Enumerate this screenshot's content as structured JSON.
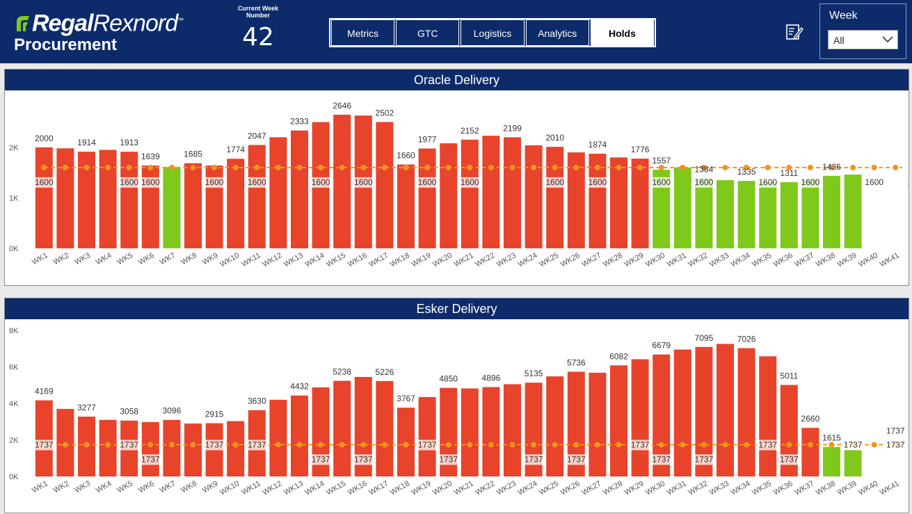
{
  "header": {
    "brand_part1": "Regal",
    "brand_part2": "Rexnord",
    "brand_mark": "™",
    "subtitle": "Procurement",
    "week_caption_line1": "Current Week",
    "week_caption_line2": "Number",
    "week_number": "42",
    "nav": [
      "Metrics",
      "GTC",
      "Logistics",
      "Analytics",
      "Holds"
    ],
    "active_tab": "Holds",
    "edit_icon": "edit-document-icon"
  },
  "slicer": {
    "label": "Week",
    "value": "All"
  },
  "colors": {
    "header": "#0d2b6b",
    "red": "#e8432b",
    "green": "#7ec91c",
    "target": "#f29422"
  },
  "oracle": {
    "title": "Oracle Delivery",
    "chart_data": {
      "type": "bar",
      "categories": [
        "WK1",
        "WK2",
        "WK3",
        "WK4",
        "WK5",
        "WK6",
        "WK7",
        "WK8",
        "WK9",
        "WK10",
        "WK11",
        "WK12",
        "WK13",
        "WK14",
        "WK15",
        "WK16",
        "WK17",
        "WK18",
        "WK19",
        "WK20",
        "WK21",
        "WK22",
        "WK23",
        "WK24",
        "WK25",
        "WK26",
        "WK27",
        "WK28",
        "WK29",
        "WK30",
        "WK31",
        "WK32",
        "WK33",
        "WK34",
        "WK35",
        "WK36",
        "WK37",
        "WK38",
        "WK39",
        "WK40",
        "WK41"
      ],
      "values": [
        2000,
        1980,
        1914,
        1950,
        1913,
        1639,
        1610,
        1685,
        1640,
        1774,
        2047,
        2200,
        2333,
        2500,
        2646,
        2630,
        2502,
        1660,
        1977,
        2080,
        2152,
        2230,
        2199,
        2040,
        2010,
        1900,
        1874,
        1800,
        1776,
        1557,
        1600,
        1384,
        1350,
        1335,
        1320,
        1311,
        1370,
        1436,
        1460,
        null,
        null
      ],
      "colors": [
        "red",
        "red",
        "red",
        "red",
        "red",
        "red",
        "green",
        "red",
        "red",
        "red",
        "red",
        "red",
        "red",
        "red",
        "red",
        "red",
        "red",
        "red",
        "red",
        "red",
        "red",
        "red",
        "red",
        "red",
        "red",
        "red",
        "red",
        "red",
        "red",
        "green",
        "green",
        "green",
        "green",
        "green",
        "green",
        "green",
        "green",
        "green",
        "green",
        "none",
        "none"
      ],
      "value_labels": [
        "2000",
        "",
        "1914",
        "",
        "1913",
        "1639",
        "",
        "1685",
        "",
        "1774",
        "2047",
        "",
        "2333",
        "",
        "2646",
        "",
        "2502",
        "1660",
        "1977",
        "",
        "2152",
        "",
        "2199",
        "",
        "2010",
        "",
        "1874",
        "",
        "1776",
        "1557",
        "",
        "1384",
        "",
        "1335",
        "",
        "1311",
        "",
        "1436",
        "",
        "",
        ""
      ],
      "target": 1600,
      "target_labels": [
        "1600",
        "",
        "",
        "",
        "1600",
        "1600",
        "",
        "",
        "1600",
        "",
        "1600",
        "",
        "",
        "1600",
        "",
        "1600",
        "",
        "",
        "1600",
        "",
        "1600",
        "",
        "",
        "",
        "1600",
        "",
        "1600",
        "",
        "",
        "1600",
        "",
        "1600",
        "",
        "",
        "1600",
        "",
        "1600",
        "",
        "",
        "1600",
        "",
        "1600"
      ],
      "yticks": [
        "0K",
        "1K",
        "2K"
      ],
      "ylim": [
        0,
        3100
      ]
    }
  },
  "esker": {
    "title": "Esker Delivery",
    "chart_data": {
      "type": "bar",
      "categories": [
        "WK1",
        "WK2",
        "WK3",
        "WK4",
        "WK5",
        "WK6",
        "WK7",
        "WK8",
        "WK9",
        "WK10",
        "WK11",
        "WK12",
        "WK13",
        "WK14",
        "WK15",
        "WK16",
        "WK17",
        "WK18",
        "WK19",
        "WK20",
        "WK21",
        "WK22",
        "WK23",
        "WK24",
        "WK25",
        "WK26",
        "WK27",
        "WK28",
        "WK29",
        "WK30",
        "WK31",
        "WK32",
        "WK33",
        "WK34",
        "WK35",
        "WK36",
        "WK37",
        "WK38",
        "WK39",
        "WK40",
        "WK41"
      ],
      "values": [
        4169,
        3700,
        3277,
        3100,
        3058,
        2980,
        3096,
        2900,
        2915,
        3030,
        3630,
        4200,
        4432,
        4880,
        5238,
        5450,
        5226,
        3767,
        4350,
        4850,
        4820,
        4896,
        5050,
        5135,
        5480,
        5736,
        5680,
        6082,
        6420,
        6679,
        6950,
        7095,
        7260,
        7026,
        6580,
        5011,
        2660,
        1615,
        1450,
        null,
        null
      ],
      "colors": [
        "red",
        "red",
        "red",
        "red",
        "red",
        "red",
        "red",
        "red",
        "red",
        "red",
        "red",
        "red",
        "red",
        "red",
        "red",
        "red",
        "red",
        "red",
        "red",
        "red",
        "red",
        "red",
        "red",
        "red",
        "red",
        "red",
        "red",
        "red",
        "red",
        "red",
        "red",
        "red",
        "red",
        "red",
        "red",
        "red",
        "red",
        "green",
        "green",
        "none",
        "none"
      ],
      "value_labels": [
        "4169",
        "",
        "3277",
        "",
        "3058",
        "",
        "3096",
        "",
        "2915",
        "",
        "3630",
        "",
        "4432",
        "",
        "5238",
        "",
        "5226",
        "3767",
        "",
        "4850",
        "",
        "4896",
        "",
        "5135",
        "",
        "5736",
        "",
        "6082",
        "",
        "6679",
        "",
        "7095",
        "",
        "7026",
        "",
        "5011",
        "2660",
        "1615",
        "",
        "",
        "1737"
      ],
      "target": 1737,
      "target_labels": [
        "1737",
        "",
        "",
        "",
        "1737",
        "1737",
        "",
        "",
        "1737",
        "",
        "1737",
        "",
        "",
        "1737",
        "",
        "1737",
        "",
        "",
        "1737",
        "1737",
        "",
        "",
        "",
        "1737",
        "",
        "1737",
        "",
        "",
        "1737",
        "1737",
        "",
        "1737",
        "",
        "",
        "1737",
        "1737",
        "",
        "",
        "1737",
        "",
        "1737"
      ],
      "yticks": [
        "0K",
        "2K",
        "4K",
        "6K",
        "8K"
      ],
      "ylim": [
        0,
        8000
      ]
    }
  }
}
